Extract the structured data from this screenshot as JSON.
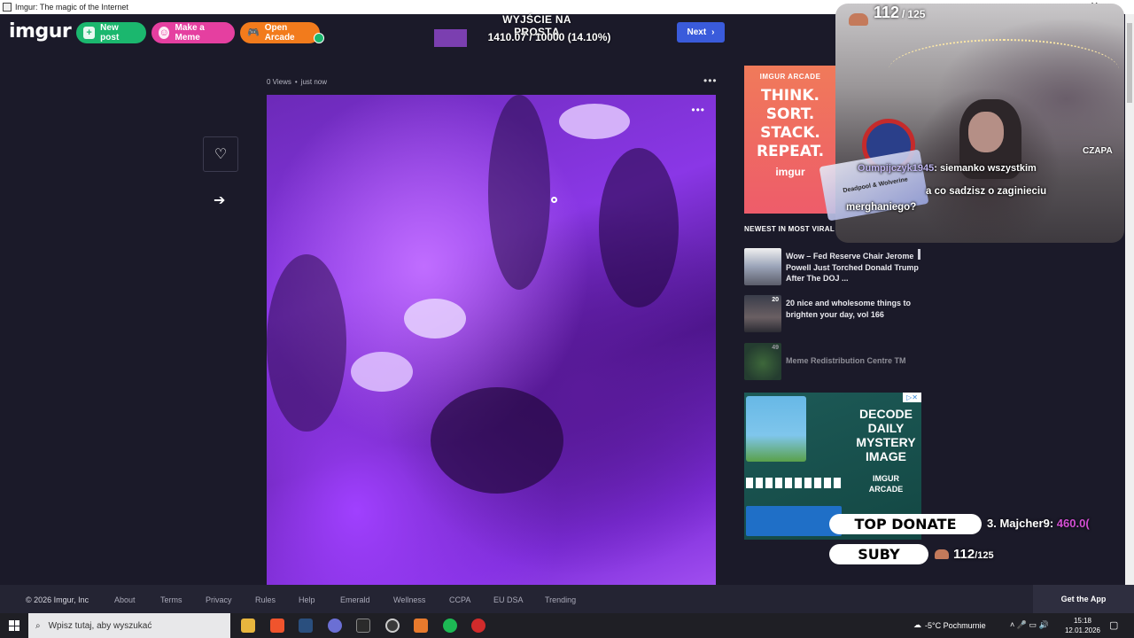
{
  "window": {
    "title": "Imgur: The magic of the Internet",
    "close_glyph": "✕"
  },
  "header": {
    "logo": "imgur",
    "new_post": "New post",
    "make_meme": "Make a Meme",
    "open_arcade": "Open Arcade",
    "next_label": "Next"
  },
  "stream_goal": {
    "title": "WYJŚCIE NA PROSTĄ",
    "value": "1410.07 / 10000 (14.10%)",
    "progress_fraction": 0.141
  },
  "post": {
    "views": "0 Views",
    "time": "just now",
    "more_glyph": "•••"
  },
  "sidebar": {
    "ad_top": {
      "label": "IMGUR ARCADE",
      "headline": "THINK. SORT. STACK. REPEAT.",
      "brand": "imgur"
    },
    "newest_label": "NEWEST IN MOST VIRAL",
    "viral": [
      {
        "title": "Wow – Fed Reserve Chair Jerome Powell Just Torched Donald Trump After The DOJ ...",
        "count": ""
      },
      {
        "title": "20 nice and wholesome things to brighten your day, vol 166",
        "count": "20"
      },
      {
        "title": "Meme Redistribution Centre TM",
        "count": "49"
      }
    ],
    "ad_bottom": {
      "headline": "DECODE DAILY MYSTERY IMAGE",
      "sub": "IMGUR ARCADE"
    }
  },
  "footer": {
    "copyright": "© 2026 Imgur, Inc",
    "links": [
      "About",
      "Terms",
      "Privacy",
      "Rules",
      "Help",
      "Emerald",
      "Wellness",
      "CCPA",
      "EU DSA",
      "Trending"
    ],
    "get_app": "Get the App"
  },
  "overlay": {
    "subs_count": "112",
    "subs_goal": "125",
    "cam_label": "CZAPA",
    "chat": [
      {
        "user": "Oumpijczyk1945",
        "message": "siemanko wszystkim"
      },
      {
        "user": "",
        "message": "a co sadzisz o zaginieciu merghaniego?"
      }
    ],
    "card_text": "Deadpool & Wolverine",
    "top_donate": "TOP DONATE",
    "top_donor": "3. Majcher9:",
    "top_donor_amount": "460.0(",
    "suby_label": "SUBY",
    "suby_count": "112",
    "suby_goal": "125"
  },
  "taskbar": {
    "search_placeholder": "Wpisz tutaj, aby wyszukać",
    "weather": "-5°C Pochmurnie",
    "time": "15:18",
    "date": "12.01.2026"
  }
}
